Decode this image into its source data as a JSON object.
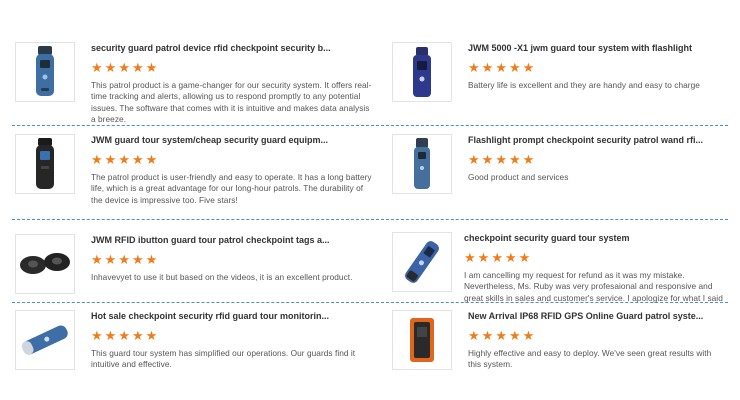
{
  "colors": {
    "star": "#f07c1a",
    "divider": "#4a90c8"
  },
  "star_icon": "★",
  "reviews": [
    {
      "title": "security guard patrol device rfid checkpoint security b...",
      "rating": 5,
      "text": "This patrol product is a game-changer for our security system. It offers real-time tracking and alerts, allowing us to respond promptly to any potential issues. The software that comes with it is intuitive and makes data analysis a breeze.",
      "image": "handheld-reader-blue-icon"
    },
    {
      "title": "JWM 5000 -X1 jwm guard tour system with flashlight",
      "rating": 5,
      "text": "Battery life is excellent and they are handy and easy to charge",
      "image": "handheld-reader-navy-icon"
    },
    {
      "title": "JWM guard tour system/cheap security guard equipm...",
      "rating": 5,
      "text": "The patrol product is user-friendly and easy to operate. It has a long battery life, which is a great advantage for our long-hour patrols. The durability of the device is impressive too. Five stars!",
      "image": "handheld-reader-black-icon"
    },
    {
      "title": "Flashlight prompt checkpoint security patrol wand rfi...",
      "rating": 5,
      "text": "Good product and services",
      "image": "patrol-wand-blue-icon"
    },
    {
      "title": "JWM RFID ibutton guard tour patrol checkpoint tags a...",
      "rating": 5,
      "text": "Inhavevyet to use it but based on the videos, it is an excellent product.",
      "image": "checkpoint-tags-icon"
    },
    {
      "title": "checkpoint security guard tour system",
      "rating": 5,
      "text": "I am cancelling my request for refund as it was my mistake. Nevertheless, Ms. Ruby was very profesaional and responsive and great skills in sales and customer's service. I apologize for what I said",
      "image": "patrol-wand-angled-icon"
    },
    {
      "title": "Hot sale checkpoint security rfid guard tour monitorin...",
      "rating": 5,
      "text": "This guard tour system has simplified our operations. Our guards find it intuitive and effective.",
      "image": "patrol-stick-blue-icon"
    },
    {
      "title": "New Arrival IP68 RFID GPS Online Guard patrol syste...",
      "rating": 5,
      "text": "Highly effective and easy to deploy. We've seen great results with this system.",
      "image": "rugged-reader-orange-icon"
    }
  ]
}
